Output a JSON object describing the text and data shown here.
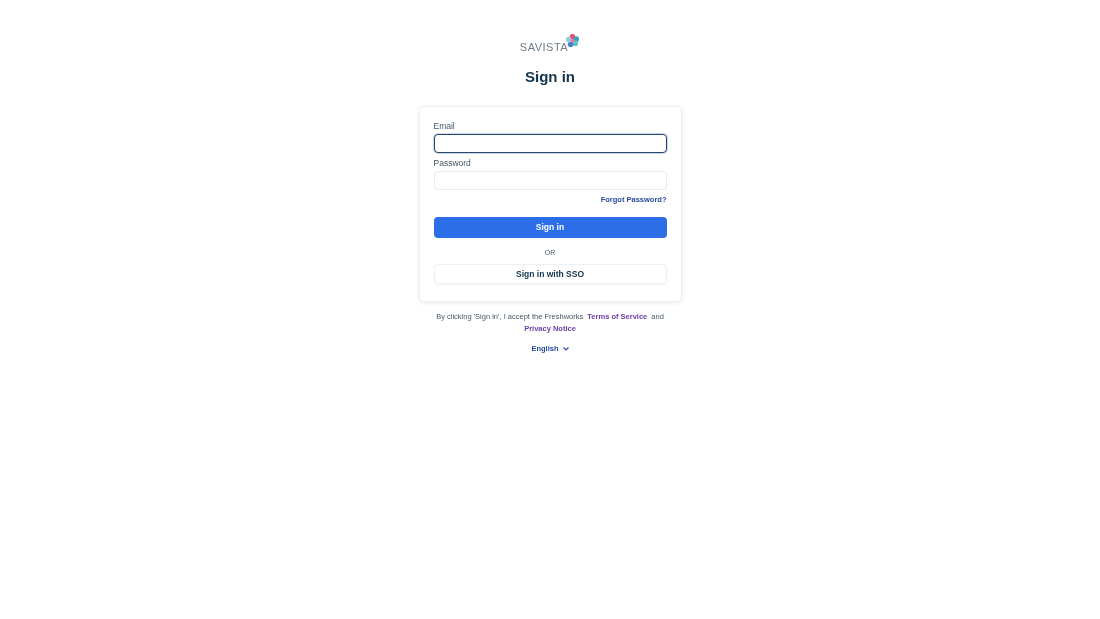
{
  "logo": {
    "wordmark": "SAVISTA"
  },
  "title": "Sign in",
  "form": {
    "fields": [
      {
        "label": "Email",
        "focused": true
      },
      {
        "label": "Password",
        "focused": false
      }
    ],
    "forgot_link": "Forgot Password?",
    "primary_button": "Sign in",
    "divider": "OR",
    "sso_button": "Sign in with SSO"
  },
  "terms": {
    "text": "By clicking 'Sign in', I accept the Freshworks",
    "terms_link": "Terms of Service",
    "joiner": "and",
    "privacy_link": "Privacy Notice"
  },
  "language": {
    "label": "English"
  }
}
